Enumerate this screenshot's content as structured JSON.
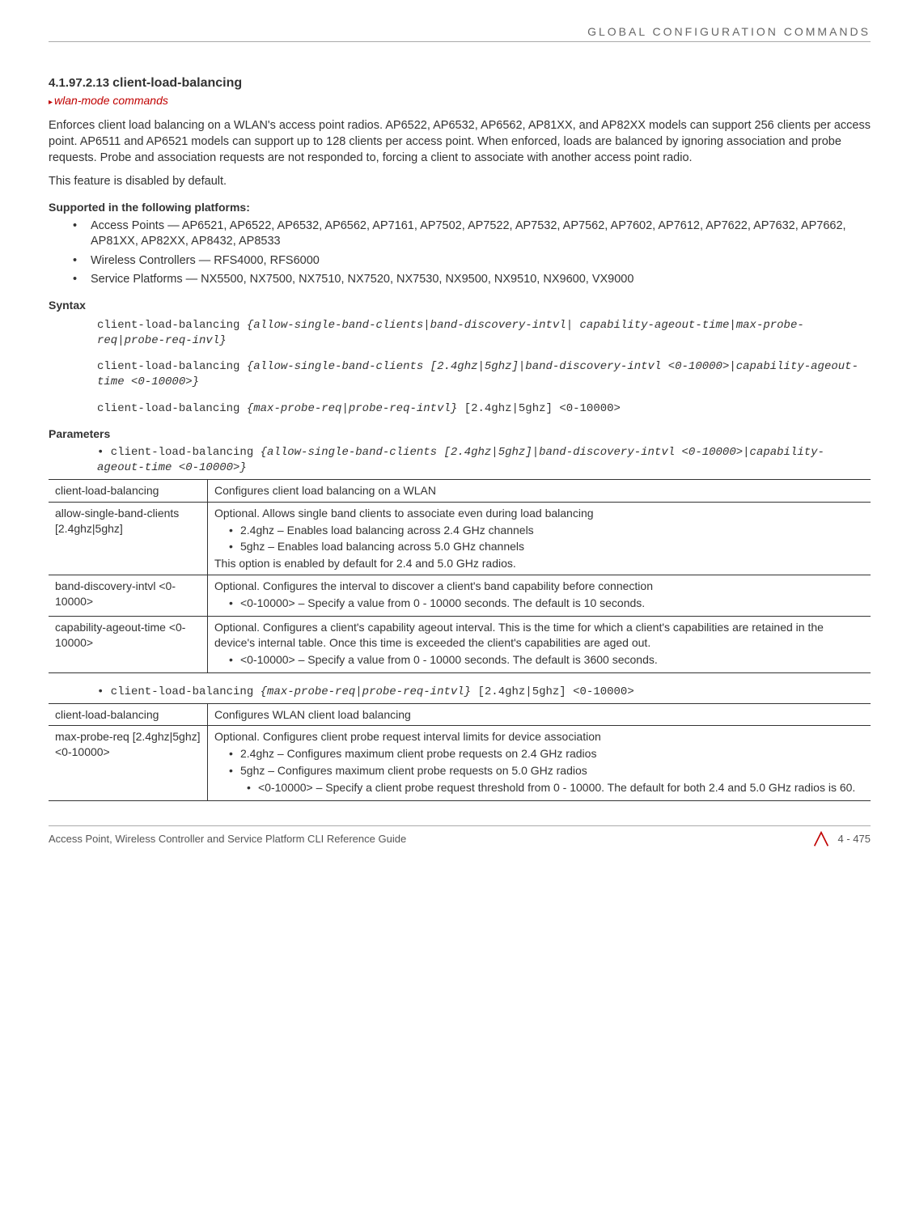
{
  "header": {
    "category": "GLOBAL CONFIGURATION COMMANDS"
  },
  "section": {
    "number": "4.1.97.2.13",
    "title": "client-load-balancing"
  },
  "breadcrumb": "wlan-mode commands",
  "intro_p1": "Enforces client load balancing on a WLAN's access point radios. AP6522, AP6532, AP6562, AP81XX, and AP82XX models can support 256 clients per access point. AP6511 and AP6521 models can support up to 128 clients per access point. When enforced, loads are balanced by ignoring association and probe requests. Probe and association requests are not responded to, forcing a client to associate with another access point radio.",
  "intro_p2": "This feature is disabled by default.",
  "supported_label": "Supported in the following platforms:",
  "platforms": {
    "ap": "Access Points — AP6521, AP6522, AP6532, AP6562, AP7161, AP7502, AP7522, AP7532, AP7562, AP7602, AP7612, AP7622, AP7632, AP7662, AP81XX, AP82XX, AP8432, AP8533",
    "wc": "Wireless Controllers — RFS4000, RFS6000",
    "sp": "Service Platforms — NX5500, NX7500, NX7510, NX7520, NX7530, NX9500, NX9510, NX9600, VX9000"
  },
  "syntax_label": "Syntax",
  "syntax": {
    "l1a": "client-load-balancing ",
    "l1b": "{allow-single-band-clients|band-discovery-intvl| capability-ageout-time|max-probe-req|probe-req-invl}",
    "l2a": "client-load-balancing ",
    "l2b": "{allow-single-band-clients [2.4ghz|5ghz]|band-discovery-intvl <0-10000>|capability-ageout-time <0-10000>}",
    "l3a": "client-load-balancing ",
    "l3b": "{max-probe-req|probe-req-intvl}",
    "l3c": " [2.4ghz|5ghz] <0-10000>"
  },
  "parameters_label": "Parameters",
  "param_lead1_a": "• client-load-balancing ",
  "param_lead1_b": "{allow-single-band-clients [2.4ghz|5ghz]|band-discovery-intvl <0-10000>|capability-ageout-time <0-10000>}",
  "table1": {
    "r1c1": "client-load-balancing",
    "r1c2": "Configures client load balancing on a WLAN",
    "r2c1": "allow-single-band-clients [2.4ghz|5ghz]",
    "r2c2_p": "Optional. Allows single band clients to associate even during load balancing",
    "r2c2_b1": "2.4ghz – Enables load balancing across 2.4 GHz channels",
    "r2c2_b2": "5ghz – Enables load balancing across 5.0 GHz channels",
    "r2c2_f": "This option is enabled by default for 2.4 and 5.0 GHz radios.",
    "r3c1": "band-discovery-intvl <0-10000>",
    "r3c2_p": "Optional. Configures the interval to discover a client's band capability before connection",
    "r3c2_b1": "<0-10000> – Specify a value from 0 - 10000 seconds. The default is 10 seconds.",
    "r4c1": "capability-ageout-time <0-10000>",
    "r4c2_p": "Optional. Configures a client's capability ageout interval. This is the time for which a client's capabilities are retained in the device's internal table. Once this time is exceeded the client's capabilities are aged out.",
    "r4c2_b1": "<0-10000> – Specify a value from 0 - 10000 seconds. The default is 3600 seconds."
  },
  "param_lead2_a": "• client-load-balancing ",
  "param_lead2_b": "{max-probe-req|probe-req-intvl}",
  "param_lead2_c": " [2.4ghz|5ghz] <0-10000>",
  "table2": {
    "r1c1": "client-load-balancing",
    "r1c2": "Configures WLAN client load balancing",
    "r2c1": "max-probe-req [2.4ghz|5ghz] <0-10000>",
    "r2c2_p": "Optional. Configures client probe request interval limits for device association",
    "r2c2_b1": "2.4ghz – Configures maximum client probe requests on 2.4 GHz radios",
    "r2c2_b2": "5ghz – Configures maximum client probe requests on 5.0 GHz radios",
    "r2c2_sub": "<0-10000> – Specify a client probe request threshold from 0 - 10000. The default for both 2.4 and 5.0 GHz radios is 60."
  },
  "footer": {
    "title": "Access Point, Wireless Controller and Service Platform CLI Reference Guide",
    "page": "4 - 475"
  }
}
